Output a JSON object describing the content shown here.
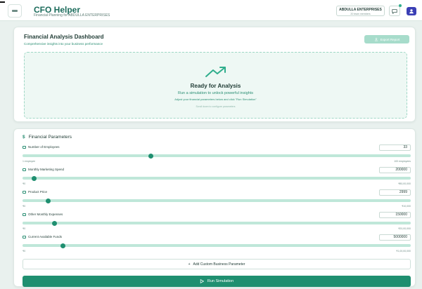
{
  "header": {
    "title": "CFO Helper",
    "subtitle": "Financial Planning for ABDULLA ENTERPRISES",
    "company_name": "ABDULLA ENTERPRISES",
    "company_meta": "20 team members"
  },
  "dashboard": {
    "title": "Financial Analysis Dashboard",
    "subtitle": "Comprehensive insights into your business performance",
    "export_label": "Export Report",
    "ready_title": "Ready for Analysis",
    "ready_line1": "Run a simulation to unlock powerful insights",
    "ready_line2": "Adjust your financial parameters below and click \"Run Simulation\"",
    "ready_line3": "Scroll down to configure parameters"
  },
  "params": {
    "heading": "Financial Parameters",
    "items": [
      {
        "label": "Number of Employees",
        "value": "33",
        "min": "1 employee",
        "max": "100 employees",
        "fraction": 0.33
      },
      {
        "label": "Monthly Marketing Spend",
        "value": "200000",
        "min": "₹0",
        "max": "₹80,00,000",
        "fraction": 0.03
      },
      {
        "label": "Product Price",
        "value": "2999",
        "min": "₹0",
        "max": "₹10,000",
        "fraction": 0.067
      },
      {
        "label": "Other Monthly Expenses",
        "value": "150000",
        "min": "₹0",
        "max": "₹20,00,000",
        "fraction": 0.083
      },
      {
        "label": "Current Available Funds",
        "value": "5000000",
        "min": "₹0",
        "max": "₹1,00,00,000",
        "fraction": 0.105
      }
    ],
    "add_label": "Add Custom Business Parameter",
    "run_label": "Run Simulation"
  },
  "colors": {
    "accent": "#1f8f70",
    "accent_light": "#bfe7d9",
    "avatar": "#3b3fb5"
  }
}
